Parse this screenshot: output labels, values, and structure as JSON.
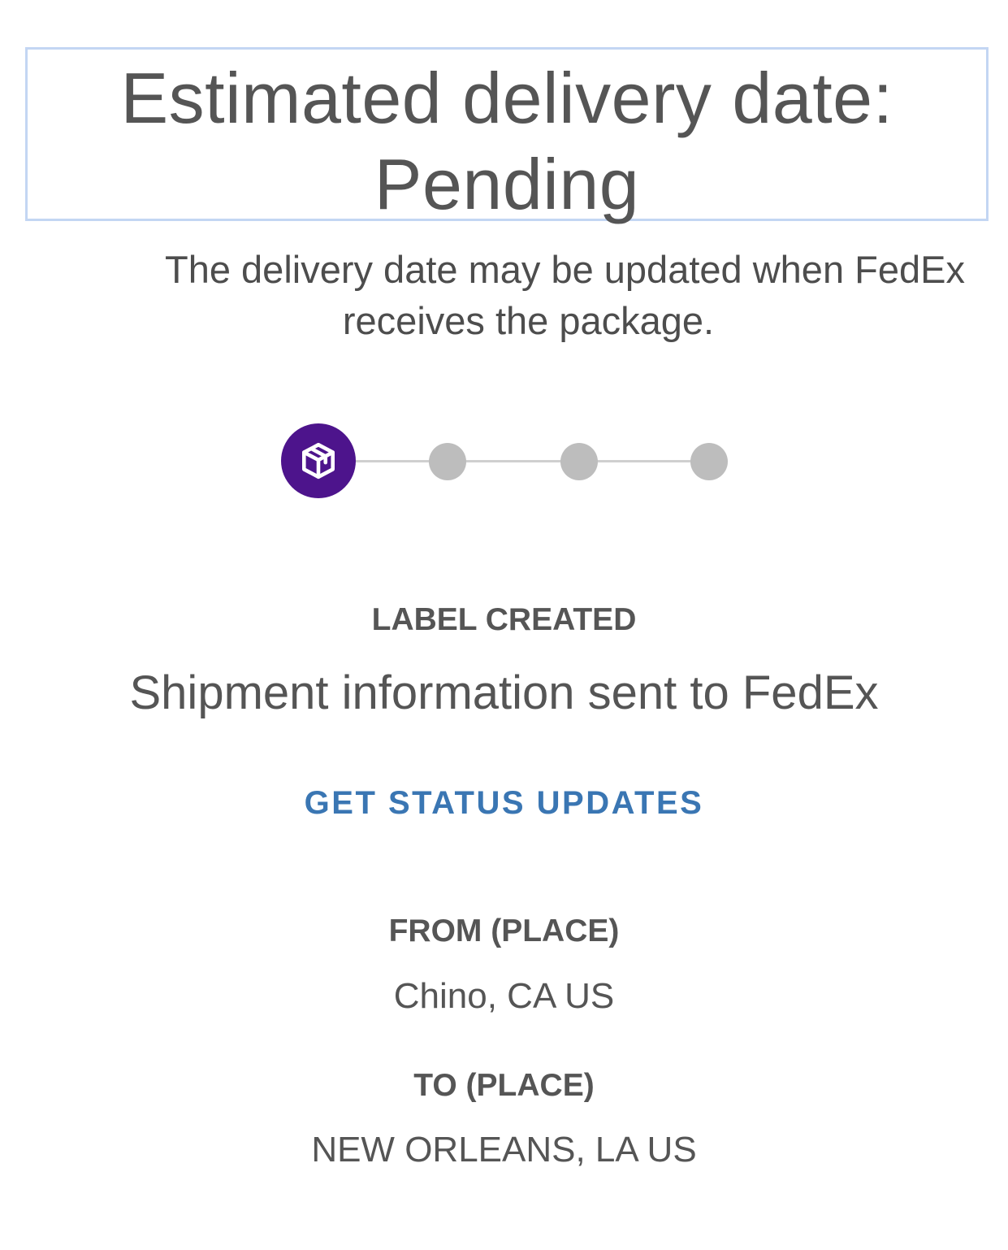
{
  "delivery": {
    "heading_line1": "Estimated delivery date:",
    "heading_line2": "Pending",
    "note_line1": "The delivery date may be updated when FedEx",
    "note_line2": "receives the package."
  },
  "progress": {
    "total_steps": 4,
    "current_step": 1,
    "active_icon": "package-icon",
    "active_color": "#4d148c",
    "inactive_color": "#bdbdbd"
  },
  "status": {
    "title": "LABEL CREATED",
    "description": "Shipment information sent to FedEx"
  },
  "actions": {
    "updates_label": "GET STATUS UPDATES",
    "link_color": "#3a76b3"
  },
  "route": {
    "from_label": "FROM (PLACE)",
    "from_value": "Chino, CA US",
    "to_label": "TO (PLACE)",
    "to_value": "NEW ORLEANS, LA US"
  }
}
